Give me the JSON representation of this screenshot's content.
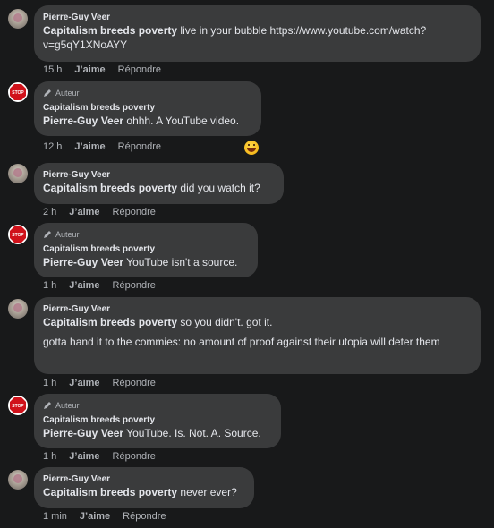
{
  "actions": {
    "like": "J’aime",
    "reply": "Répondre"
  },
  "comments": [
    {
      "author": "Pierre-Guy Veer",
      "mention": "Capitalism breeds poverty",
      "text": " live in your bubble https://www.youtube.com/watch?v=g5qY1XNoAYY",
      "time": "15 h"
    },
    {
      "badge": "Auteur",
      "author": "Capitalism breeds poverty",
      "mention": "Pierre-Guy Veer",
      "text": " ohhh. A YouTube video.",
      "time": "12 h",
      "reaction": "laughing-emoji"
    },
    {
      "author": "Pierre-Guy Veer",
      "mention": "Capitalism breeds poverty",
      "text": " did you watch it?",
      "time": "2 h"
    },
    {
      "badge": "Auteur",
      "author": "Capitalism breeds poverty",
      "mention": "Pierre-Guy Veer",
      "text": " YouTube isn't a source.",
      "time": "1 h"
    },
    {
      "author": "Pierre-Guy Veer",
      "mention": "Capitalism breeds poverty",
      "text": " so you didn't. got it.",
      "text2": "gotta hand it to the commies: no amount of proof against their utopia will deter them",
      "time": "1 h"
    },
    {
      "badge": "Auteur",
      "author": "Capitalism breeds poverty",
      "mention": "Pierre-Guy Veer",
      "text": " YouTube. Is. Not. A. Source.",
      "time": "1 h"
    },
    {
      "author": "Pierre-Guy Veer",
      "mention": "Capitalism breeds poverty",
      "text": " never ever?",
      "time": "1 min"
    }
  ]
}
